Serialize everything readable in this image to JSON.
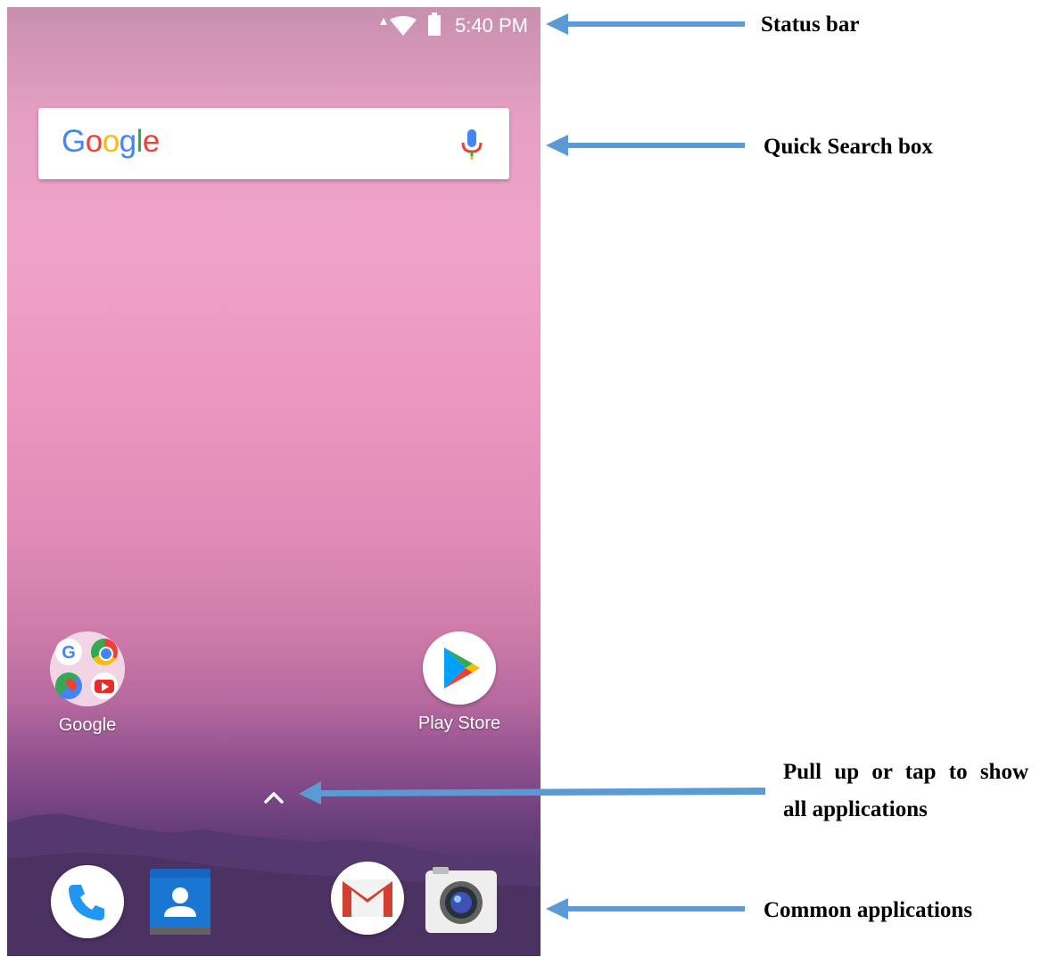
{
  "status_bar": {
    "time": "5:40 PM"
  },
  "search": {
    "logo_text": "Google"
  },
  "home_apps": [
    {
      "label": "Google"
    },
    {
      "label": "Play Store"
    }
  ],
  "dock": [
    "phone-icon",
    "contacts-icon",
    "gmail-icon",
    "camera-icon"
  ],
  "annotations": {
    "status_bar": "Status bar",
    "quick_search": "Quick Search box",
    "pull_up_line1": "Pull up or tap to show",
    "pull_up_line2": "all applications",
    "common_apps": "Common applications"
  },
  "colors": {
    "arrow": "#5b9bd5",
    "google_blue": "#4285F4",
    "google_red": "#EA4335",
    "google_yellow": "#FBBC05",
    "google_green": "#34A853"
  }
}
